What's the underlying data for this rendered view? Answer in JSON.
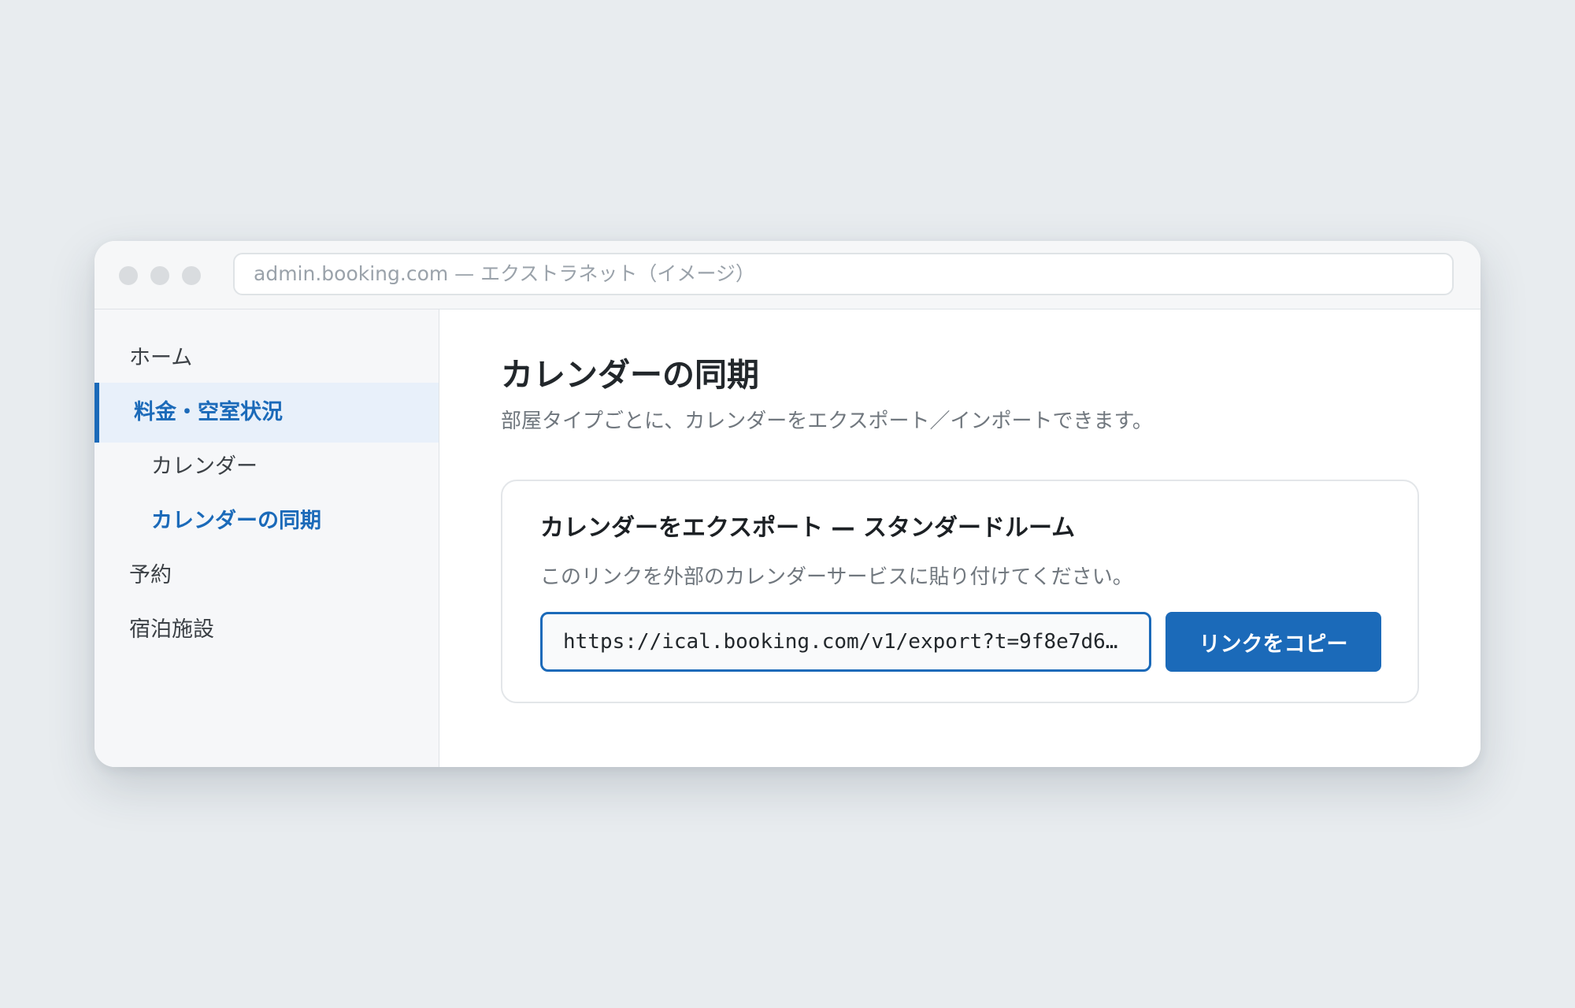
{
  "browser": {
    "address": "admin.booking.com — エクストラネット（イメージ）"
  },
  "sidebar": {
    "items": [
      {
        "label": "ホーム"
      },
      {
        "label": "料金・空室状況"
      },
      {
        "label": "カレンダー"
      },
      {
        "label": "カレンダーの同期"
      },
      {
        "label": "予約"
      },
      {
        "label": "宿泊施設"
      }
    ]
  },
  "main": {
    "title": "カレンダーの同期",
    "description": "部屋タイプごとに、カレンダーをエクスポート／インポートできます。",
    "card": {
      "title": "カレンダーをエクスポート — スタンダードルーム",
      "description": "このリンクを外部のカレンダーサービスに貼り付けてください。",
      "url_value": "https://ical.booking.com/v1/export?t=9f8e7d6…",
      "copy_label": "リンクをコピー"
    }
  },
  "colors": {
    "accent": "#1b6ab9",
    "background": "#e8ecef",
    "sidebar_bg": "#f6f7f9",
    "active_bg": "#e8f0fa"
  }
}
